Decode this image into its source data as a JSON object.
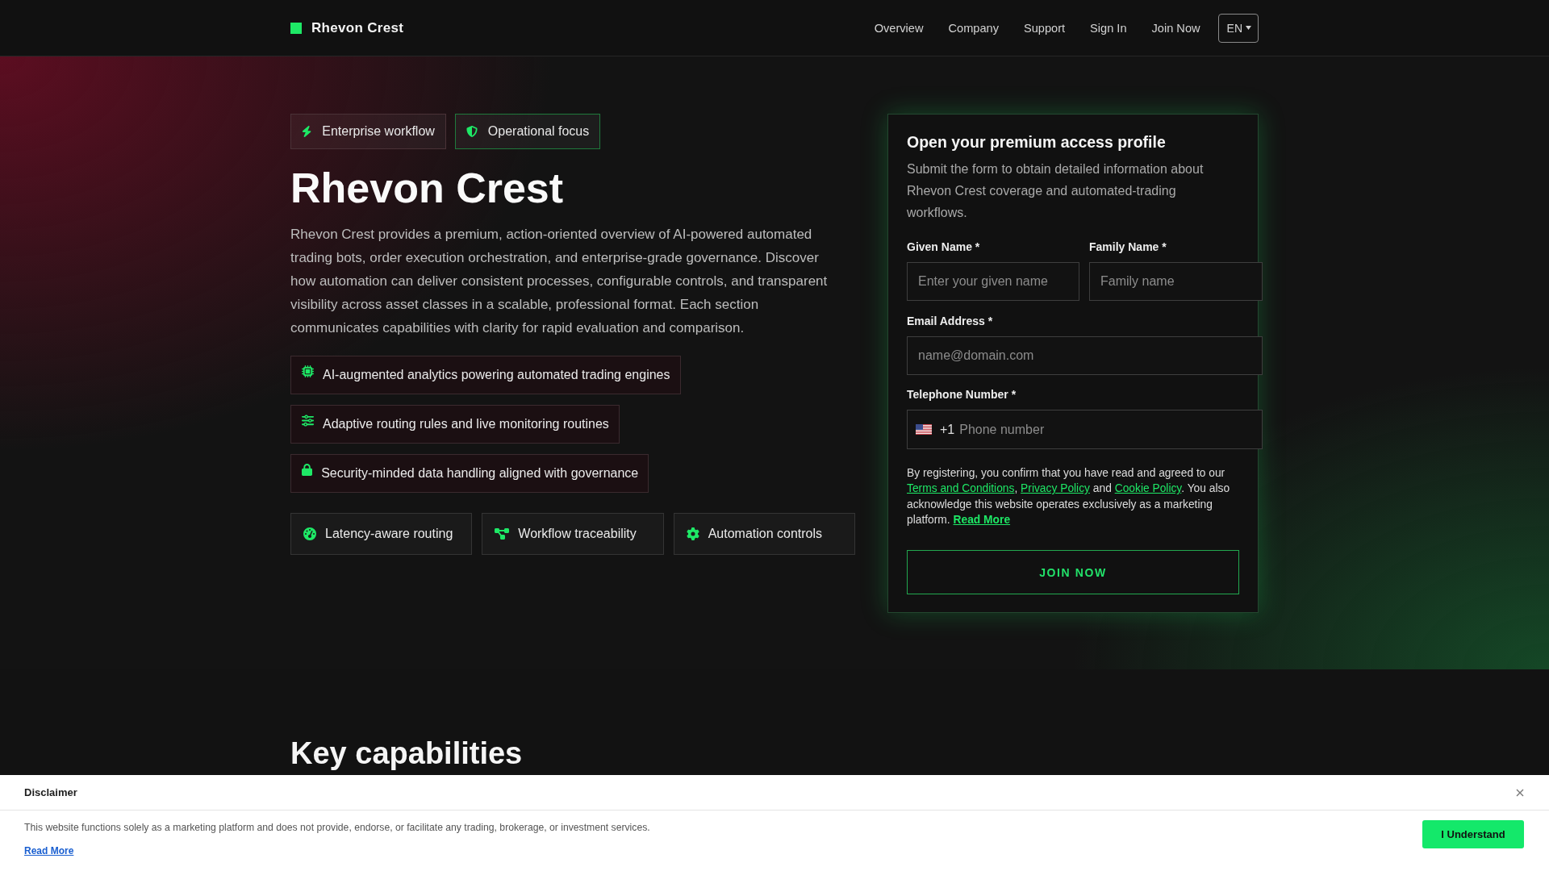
{
  "header": {
    "brand": "Rhevon Crest",
    "nav": [
      {
        "label": "Overview"
      },
      {
        "label": "Company"
      },
      {
        "label": "Support"
      },
      {
        "label": "Sign In"
      },
      {
        "label": "Join Now"
      }
    ],
    "language": "EN"
  },
  "hero": {
    "badges": [
      {
        "label": "Enterprise workflow",
        "highlighted": false
      },
      {
        "label": "Operational focus",
        "highlighted": true
      }
    ],
    "title": "Rhevon Crest",
    "description": "Rhevon Crest provides a premium, action-oriented overview of AI-powered automated trading bots, order execution orchestration, and enterprise-grade governance. Discover how automation can deliver consistent processes, configurable controls, and transparent visibility across asset classes in a scalable, professional format. Each section communicates capabilities with clarity for rapid evaluation and comparison.",
    "highlights": [
      "AI-augmented analytics powering automated trading engines",
      "Adaptive routing rules and live monitoring routines",
      "Security-minded data handling aligned with governance"
    ],
    "features": [
      "Latency-aware routing",
      "Workflow traceability",
      "Automation controls"
    ]
  },
  "form": {
    "title": "Open your premium access profile",
    "description": "Submit the form to obtain detailed information about Rhevon Crest coverage and automated-trading workflows.",
    "name_fields": [
      {
        "label": "Given Name *",
        "placeholder": "Enter your given name"
      },
      {
        "label": "Family Name *",
        "placeholder": "Family name"
      }
    ],
    "email_field": {
      "label": "Email Address *",
      "placeholder": "name@domain.com"
    },
    "phone_field": {
      "label": "Telephone Number *",
      "dial_code": "+1",
      "placeholder": "Phone number"
    },
    "consent": [
      {
        "kind": "text",
        "text": "By registering, you confirm that you have read and agreed to our "
      },
      {
        "kind": "link",
        "text": "Terms and Conditions"
      },
      {
        "kind": "text",
        "text": ", "
      },
      {
        "kind": "link",
        "text": "Privacy Policy"
      },
      {
        "kind": "text",
        "text": " and "
      },
      {
        "kind": "link",
        "text": "Cookie Policy"
      },
      {
        "kind": "text",
        "text": ". You also acknowledge this website operates exclusively as a marketing platform. "
      },
      {
        "kind": "strong_link",
        "text": "Read More"
      }
    ],
    "submit": "JOIN NOW"
  },
  "section": {
    "heading": "Key capabilities"
  },
  "disclaimer": {
    "title": "Disclaimer",
    "text": "This website functions solely as a marketing platform and does not provide, endorse, or facilitate any trading, brokerage, or investment services.",
    "link": "Read More",
    "button": "I Understand"
  }
}
